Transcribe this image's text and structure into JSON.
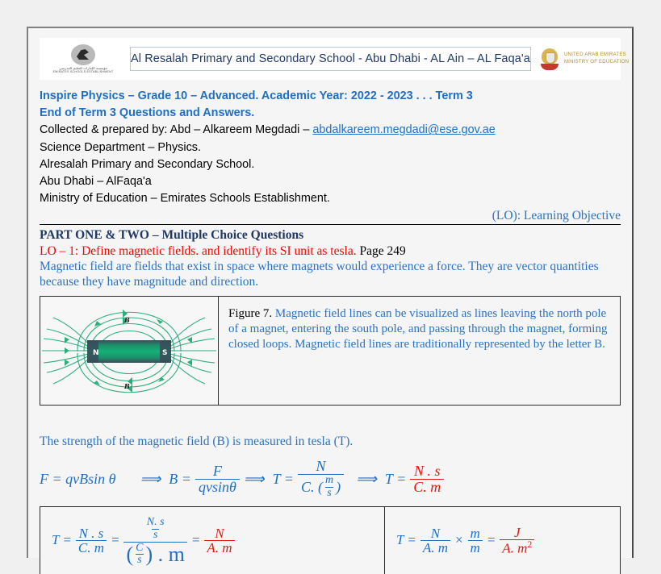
{
  "letterhead": {
    "left_logo": {
      "name": "emirates-schools-establishment-logo",
      "arabic_text": "مؤسسة الإمارات للتعليم المدرسي",
      "english_text": "EMIRATES SCHOOLS ESTABLISHMENT"
    },
    "school_title": "Al Resalah Primary and Secondary School - Abu Dhabi - AL Ain – AL Faqa'a",
    "right_logo": {
      "name": "uae-ministry-of-education-logo",
      "line1": "UNITED ARAB EMIRATES",
      "line2": "MINISTRY OF EDUCATION"
    }
  },
  "intro": {
    "line1": "Inspire Physics – Grade 10 – Advanced.  Academic Year: 2022 - 2023 . . . Term 3",
    "line2": "End of Term 3 Questions and Answers.",
    "line3_prefix": "Collected & prepared by: Abd – Alkareem Megdadi – ",
    "line3_email": "abdalkareem.megdadi@ese.gov.ae",
    "line4": "Science Department – Physics.",
    "line5": "Alresalah Primary and Secondary School.",
    "line6": "Abu Dhabi – AlFaqa'a",
    "line7": "Ministry of Education – Emirates Schools Establishment.",
    "lo_legend": "(LO): Learning Objective"
  },
  "part": {
    "title": "PART ONE & TWO – Multiple Choice Questions",
    "lo_text": "LO – 1: Define magnetic fields. and identify its SI unit as tesla.",
    "page_ref": "Page 249",
    "definition": "Magnetic field are fields that exist in space where magnets would experience a force. They are vector quantities because they have magnitude and direction."
  },
  "figure": {
    "name": "magnetic-field-lines-bar-magnet",
    "north_label": "N",
    "south_label": "S",
    "field_label_top": "B",
    "field_label_bottom": "B",
    "caption_number": "Figure 7.",
    "caption_text": " Magnetic field lines can be visualized as lines leaving the north pole of a magnet, entering the south pole, and passing through the magnet, forming closed loops. Magnetic field lines are traditionally represented by the letter B.",
    "colors": {
      "field_line": "#2eae7d",
      "magnet_dark": "#3c4a5a",
      "magnet_green": "#14a06e"
    }
  },
  "tesla": {
    "sentence": "The strength of the magnetic field (B) is measured in tesla (T)."
  },
  "equations": {
    "row1": {
      "lhs": "F = qvBsin θ",
      "arrow1": "⟹",
      "b_symbol": "B =",
      "frac1_num": "F",
      "frac1_den": "qvsinθ",
      "arrow2": "⟹",
      "t_symbol1": "T =",
      "frac2_num": "N",
      "frac2_den_prefix": "C. (",
      "frac2_den_inner_num": "m",
      "frac2_den_inner_den": "s",
      "frac2_den_suffix": ")",
      "arrow3": "⟹",
      "t_symbol2": "T =",
      "frac3_num": "N . s",
      "frac3_den": "C. m"
    },
    "cell_left": {
      "t_symbol": "T =",
      "f1_num": "N . s",
      "f1_den": "C. m",
      "eq1": "=",
      "f2_num_num": "N. s",
      "f2_num_den": "s",
      "f2_den_paren_open": "(",
      "f2_den_inner_num": "C",
      "f2_den_inner_den": "s",
      "f2_den_paren_close": ") . m",
      "eq2": "=",
      "f3_num": "N",
      "f3_den": "A. m"
    },
    "cell_right": {
      "t_symbol": "T =",
      "f1_num": "N",
      "f1_den": "A. m",
      "times": "×",
      "f2_num": "m",
      "f2_den": "m",
      "eq": "=",
      "f3_num": "J",
      "f3_den": "A. m",
      "f3_den_sup": "2"
    }
  },
  "colors": {
    "heading_blue": "#1f3864",
    "body_blue": "#2a72c4",
    "link_blue": "#1f6fc4",
    "red": "#ff0000",
    "equation_red": "#e8160c"
  }
}
